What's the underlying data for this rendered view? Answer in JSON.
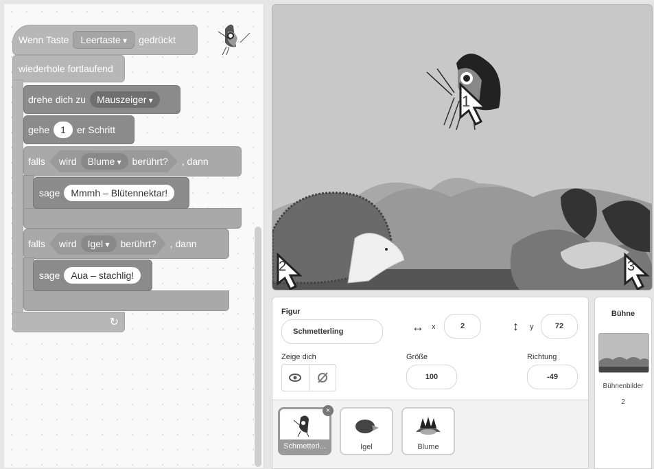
{
  "code": {
    "hat": {
      "prefix": "Wenn Taste",
      "key": "Leertaste",
      "suffix": "gedrückt"
    },
    "forever_label": "wiederhole fortlaufend",
    "turn": {
      "prefix": "drehe dich zu",
      "target": "Mauszeiger"
    },
    "move": {
      "prefix": "gehe",
      "steps": "1",
      "suffix": "er Schritt"
    },
    "if1": {
      "prefix": "falls",
      "sense_prefix": "wird",
      "target": "Blume",
      "sense_suffix": "berührt?",
      "suffix": ", dann"
    },
    "say1": {
      "prefix": "sage",
      "text": "Mmmh – Blütennektar!"
    },
    "if2": {
      "prefix": "falls",
      "sense_prefix": "wird",
      "target": "Igel",
      "sense_suffix": "berührt?",
      "suffix": ", dann"
    },
    "say2": {
      "prefix": "sage",
      "text": "Aua – stachlig!"
    },
    "loop_arrow": "↻"
  },
  "stage": {
    "markers": [
      "1",
      "2",
      "3"
    ]
  },
  "sprite_info": {
    "figur_label": "Figur",
    "figur_name": "Schmetterling",
    "x_arrow": "↔",
    "x_label": "x",
    "x": "2",
    "y_arrow": "↕",
    "y_label": "y",
    "y": "72",
    "show_label": "Zeige dich",
    "size_label": "Größe",
    "size": "100",
    "dir_label": "Richtung",
    "direction": "-49"
  },
  "sprites": [
    {
      "name": "Schmetterl..."
    },
    {
      "name": "Igel"
    },
    {
      "name": "Blume"
    }
  ],
  "buehne": {
    "title": "Bühne",
    "backdrops_label": "Bühnenbilder",
    "backdrops_count": "2"
  }
}
